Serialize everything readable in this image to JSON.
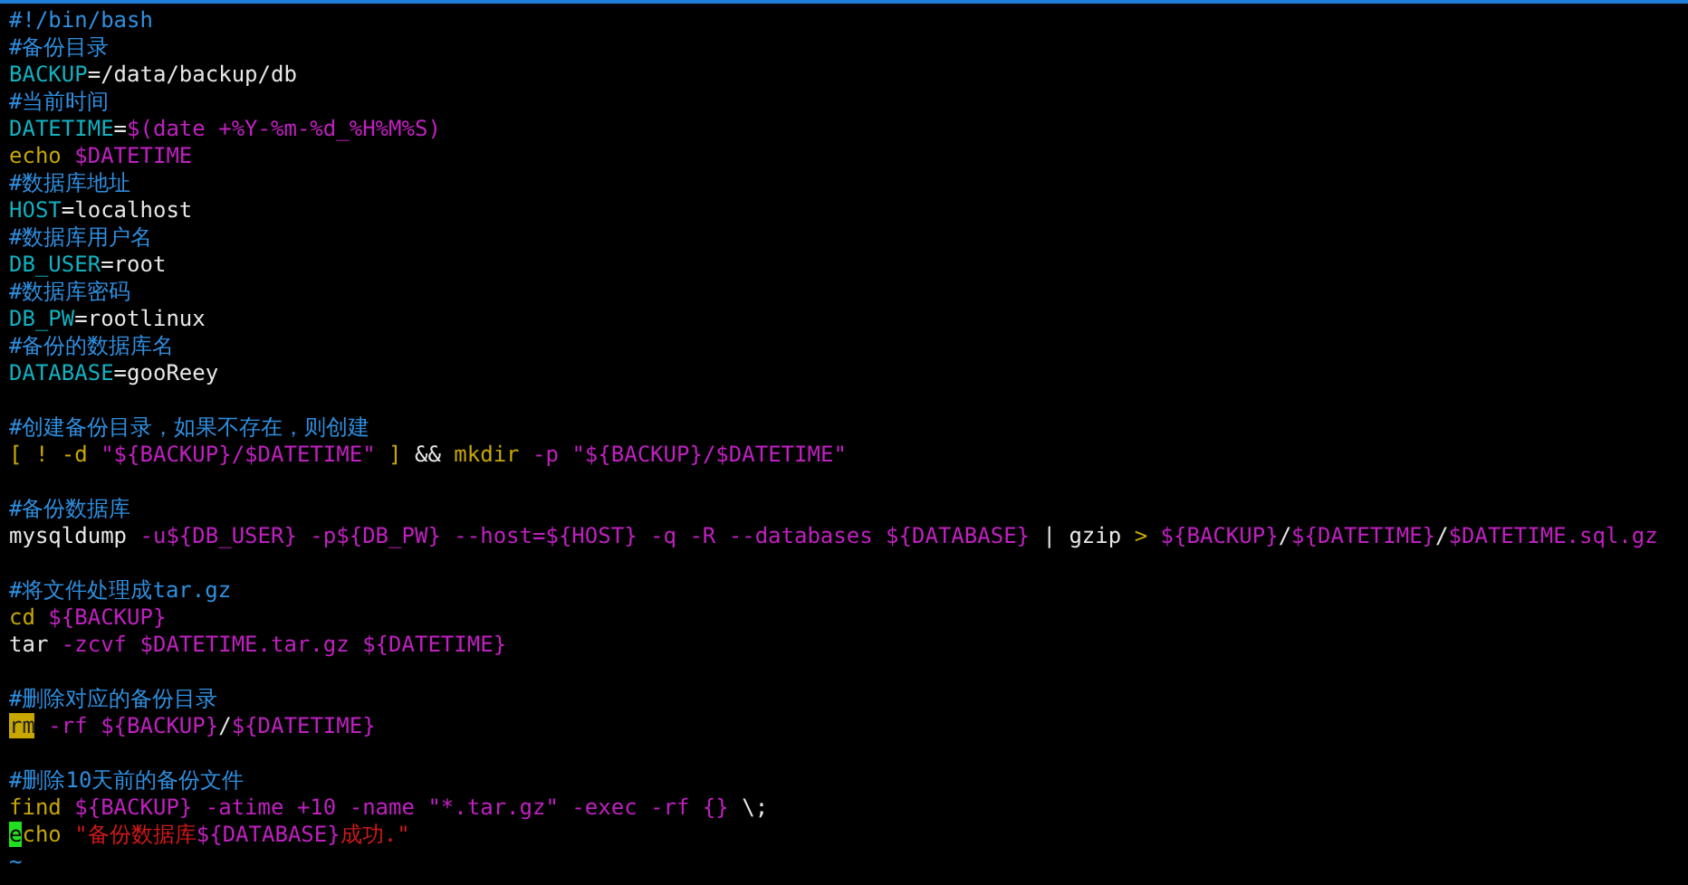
{
  "editor": {
    "lines": [
      {
        "kind": "code",
        "segments": [
          {
            "kind": "comment",
            "text": "#!/bin/bash"
          }
        ]
      },
      {
        "kind": "code",
        "segments": [
          {
            "kind": "comment",
            "text": "#备份目录"
          }
        ]
      },
      {
        "kind": "code",
        "segments": [
          {
            "kind": "variable",
            "text": "BACKUP"
          },
          {
            "kind": "plain",
            "text": "=/data/backup/db"
          }
        ]
      },
      {
        "kind": "code",
        "segments": [
          {
            "kind": "comment",
            "text": "#当前时间"
          }
        ]
      },
      {
        "kind": "code",
        "segments": [
          {
            "kind": "variable",
            "text": "DATETIME"
          },
          {
            "kind": "plain",
            "text": "="
          },
          {
            "kind": "special",
            "text": "$(date +%Y-%m-%d_%H%M%S)"
          }
        ]
      },
      {
        "kind": "code",
        "segments": [
          {
            "kind": "keyword",
            "text": "echo"
          },
          {
            "kind": "special",
            "text": " $DATETIME"
          }
        ]
      },
      {
        "kind": "code",
        "segments": [
          {
            "kind": "comment",
            "text": "#数据库地址"
          }
        ]
      },
      {
        "kind": "code",
        "segments": [
          {
            "kind": "variable",
            "text": "HOST"
          },
          {
            "kind": "plain",
            "text": "=localhost"
          }
        ]
      },
      {
        "kind": "code",
        "segments": [
          {
            "kind": "comment",
            "text": "#数据库用户名"
          }
        ]
      },
      {
        "kind": "code",
        "segments": [
          {
            "kind": "variable",
            "text": "DB_USER"
          },
          {
            "kind": "plain",
            "text": "=root"
          }
        ]
      },
      {
        "kind": "code",
        "segments": [
          {
            "kind": "comment",
            "text": "#数据库密码"
          }
        ]
      },
      {
        "kind": "code",
        "segments": [
          {
            "kind": "variable",
            "text": "DB_PW"
          },
          {
            "kind": "plain",
            "text": "=rootlinux"
          }
        ]
      },
      {
        "kind": "code",
        "segments": [
          {
            "kind": "comment",
            "text": "#备份的数据库名"
          }
        ]
      },
      {
        "kind": "code",
        "segments": [
          {
            "kind": "variable",
            "text": "DATABASE"
          },
          {
            "kind": "plain",
            "text": "=gooReey"
          }
        ]
      },
      {
        "kind": "blank"
      },
      {
        "kind": "code",
        "segments": [
          {
            "kind": "comment",
            "text": "#创建备份目录，如果不存在，则创建"
          }
        ]
      },
      {
        "kind": "code",
        "segments": [
          {
            "kind": "keyword",
            "text": "[ ! -d "
          },
          {
            "kind": "special",
            "text": "\"${BACKUP}/$DATETIME\""
          },
          {
            "kind": "keyword",
            "text": " ] "
          },
          {
            "kind": "plain",
            "text": "&&"
          },
          {
            "kind": "keyword",
            "text": " mkdir"
          },
          {
            "kind": "special",
            "text": " -p \"${BACKUP}/$DATETIME\""
          }
        ]
      },
      {
        "kind": "blank"
      },
      {
        "kind": "code",
        "segments": [
          {
            "kind": "comment",
            "text": "#备份数据库"
          }
        ]
      },
      {
        "kind": "code",
        "segments": [
          {
            "kind": "plain",
            "text": "mysqldump"
          },
          {
            "kind": "special",
            "text": " -u${DB_USER} -p${DB_PW} --host=${HOST} -q -R --databases ${DATABASE}"
          },
          {
            "kind": "plain",
            "text": " | gzip "
          },
          {
            "kind": "keyword",
            "text": ">"
          },
          {
            "kind": "special",
            "text": " ${BACKUP}"
          },
          {
            "kind": "plain",
            "text": "/"
          },
          {
            "kind": "special",
            "text": "${DATETIME}"
          },
          {
            "kind": "plain",
            "text": "/"
          },
          {
            "kind": "special",
            "text": "$DATETIME.sql.gz"
          }
        ]
      },
      {
        "kind": "blank"
      },
      {
        "kind": "code",
        "segments": [
          {
            "kind": "comment",
            "text": "#将文件处理成tar.gz"
          }
        ]
      },
      {
        "kind": "code",
        "segments": [
          {
            "kind": "keyword",
            "text": "cd"
          },
          {
            "kind": "special",
            "text": " ${BACKUP}"
          }
        ]
      },
      {
        "kind": "code",
        "segments": [
          {
            "kind": "plain",
            "text": "tar"
          },
          {
            "kind": "special",
            "text": " -zcvf $DATETIME.tar.gz ${DATETIME}"
          }
        ]
      },
      {
        "kind": "blank"
      },
      {
        "kind": "code",
        "segments": [
          {
            "kind": "comment",
            "text": "#删除对应的备份目录"
          }
        ]
      },
      {
        "kind": "code",
        "segments": [
          {
            "kind": "match",
            "text": "rm"
          },
          {
            "kind": "special",
            "text": " -rf ${BACKUP}"
          },
          {
            "kind": "plain",
            "text": "/"
          },
          {
            "kind": "special",
            "text": "${DATETIME}"
          }
        ]
      },
      {
        "kind": "blank"
      },
      {
        "kind": "code",
        "segments": [
          {
            "kind": "comment",
            "text": "#删除10天前的备份文件"
          }
        ]
      },
      {
        "kind": "code",
        "segments": [
          {
            "kind": "keyword",
            "text": "find"
          },
          {
            "kind": "special",
            "text": " ${BACKUP} -atime +10 -name \"*.tar.gz\" -exec -rf {}"
          },
          {
            "kind": "plain",
            "text": " \\;"
          }
        ]
      },
      {
        "kind": "code",
        "segments": [
          {
            "kind": "cursor",
            "text": "e"
          },
          {
            "kind": "keyword",
            "text": "cho"
          },
          {
            "kind": "string",
            "text": " \"备份数据库"
          },
          {
            "kind": "special",
            "text": "${DATABASE}"
          },
          {
            "kind": "string",
            "text": "成功.\""
          }
        ]
      },
      {
        "kind": "tilde",
        "text": "~"
      }
    ]
  }
}
